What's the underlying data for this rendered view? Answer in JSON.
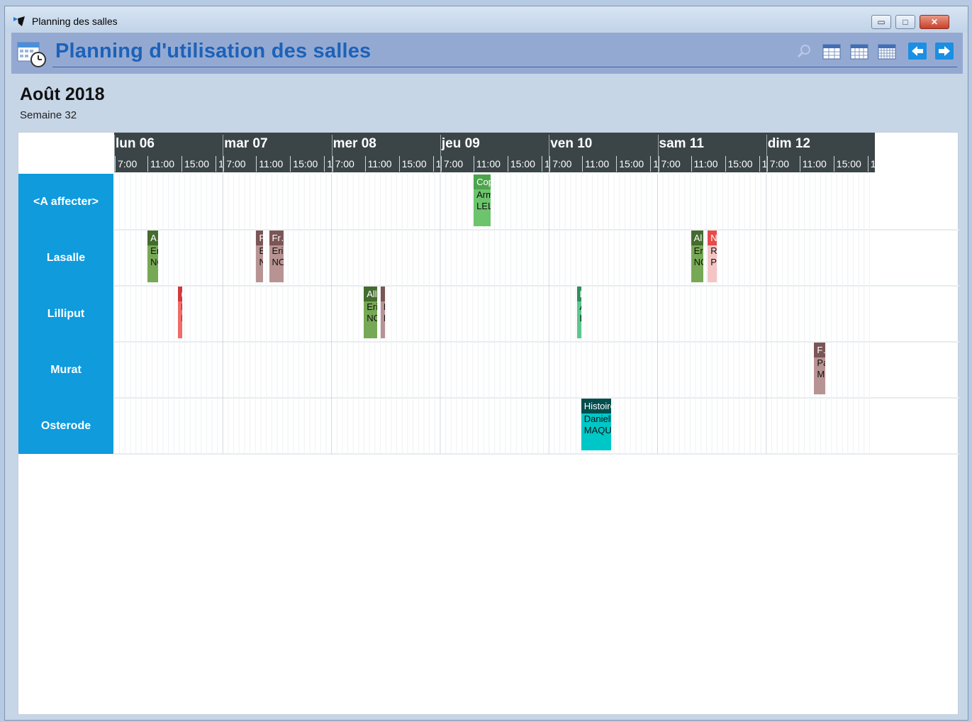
{
  "window": {
    "title": "Planning des salles",
    "minimize": "▭",
    "maximize": "□",
    "close": "✕"
  },
  "banner": {
    "title": "Planning d'utilisation des salles",
    "tools": [
      "zoom-icon",
      "calendar-day-icon",
      "calendar-week-icon",
      "calendar-month-icon",
      "arrow-left-icon",
      "arrow-right-icon"
    ]
  },
  "period": {
    "month": "Août 2018",
    "week": "Semaine 32"
  },
  "days": [
    {
      "name": "lun 06",
      "ticks": [
        "7:00",
        "11:00",
        "15:00",
        "1"
      ]
    },
    {
      "name": "mar 07",
      "ticks": [
        "7:00",
        "11:00",
        "15:00",
        "1"
      ]
    },
    {
      "name": "mer 08",
      "ticks": [
        "7:00",
        "11:00",
        "15:00",
        "1"
      ]
    },
    {
      "name": "jeu 09",
      "ticks": [
        "7:00",
        "11:00",
        "15:00",
        "1"
      ]
    },
    {
      "name": "ven 10",
      "ticks": [
        "7:00",
        "11:00",
        "15:00",
        "1"
      ]
    },
    {
      "name": "sam 11",
      "ticks": [
        "7:00",
        "11:00",
        "15:00",
        "1"
      ]
    },
    {
      "name": "dim 12",
      "ticks": [
        "7:00",
        "11:00",
        "15:00",
        "1"
      ]
    }
  ],
  "rooms": [
    "<A affecter>",
    "Lasalle",
    "Lilliput",
    "Murat",
    "Osterode"
  ],
  "events": [
    {
      "room": 0,
      "day": 3,
      "start": 11.0,
      "end": 14.0,
      "title": "Cop…",
      "line1": "Armelle",
      "line2": "LELONI",
      "color": "#6cc46c",
      "head": "#4ca54c"
    },
    {
      "room": 1,
      "day": 0,
      "start": 11.0,
      "end": 12.9,
      "title": "A…",
      "line1": "Eric",
      "line2": "NOL",
      "color": "#77a855",
      "head": "#446c30"
    },
    {
      "room": 1,
      "day": 1,
      "start": 11.0,
      "end": 12.2,
      "title": "F.",
      "line1": "Er",
      "line2": "NC",
      "color": "#b89393",
      "head": "#7b5656"
    },
    {
      "room": 1,
      "day": 1,
      "start": 13.3,
      "end": 15.9,
      "title": "Fr…",
      "line1": "Eric",
      "line2": "NOLC",
      "color": "#b89393",
      "head": "#7b5656"
    },
    {
      "room": 1,
      "day": 5,
      "start": 11.0,
      "end": 13.2,
      "title": "Al…",
      "line1": "Eric",
      "line2": "NOL(",
      "color": "#77a855",
      "head": "#446c30"
    },
    {
      "room": 1,
      "day": 5,
      "start": 14.0,
      "end": 15.6,
      "title": "N…",
      "line1": "Rol",
      "line2": "PIÇ",
      "color": "#f5c5c5",
      "head": "#e64b4b"
    },
    {
      "room": 2,
      "day": 0,
      "start": 16.5,
      "end": 17.0,
      "title": "(",
      "line1": "F",
      "line2": "F",
      "color": "#f26a6a",
      "head": "#d23a3a"
    },
    {
      "room": 2,
      "day": 2,
      "start": 10.8,
      "end": 13.2,
      "title": "All…",
      "line1": "Eric",
      "line2": "NOLC",
      "color": "#77a855",
      "head": "#446c30"
    },
    {
      "room": 2,
      "day": 2,
      "start": 13.8,
      "end": 14.3,
      "title": "",
      "line1": "I",
      "line2": "I",
      "color": "#b89393",
      "head": "#7b5656"
    },
    {
      "room": 2,
      "day": 4,
      "start": 10.0,
      "end": 10.8,
      "title": "L",
      "line1": "A",
      "line2": "LI",
      "color": "#5cc78e",
      "head": "#2f8f5c"
    },
    {
      "room": 3,
      "day": 6,
      "start": 13.6,
      "end": 15.6,
      "title": "F…",
      "line1": "Pasc",
      "line2": "MOL",
      "color": "#b89393",
      "head": "#7b5656"
    },
    {
      "room": 4,
      "day": 4,
      "start": 10.8,
      "end": 16.2,
      "title": "Histoire …",
      "line1": "Daniella",
      "line2": "MAQUEL",
      "color": "#00c7c7",
      "head": "#054d4d"
    }
  ]
}
